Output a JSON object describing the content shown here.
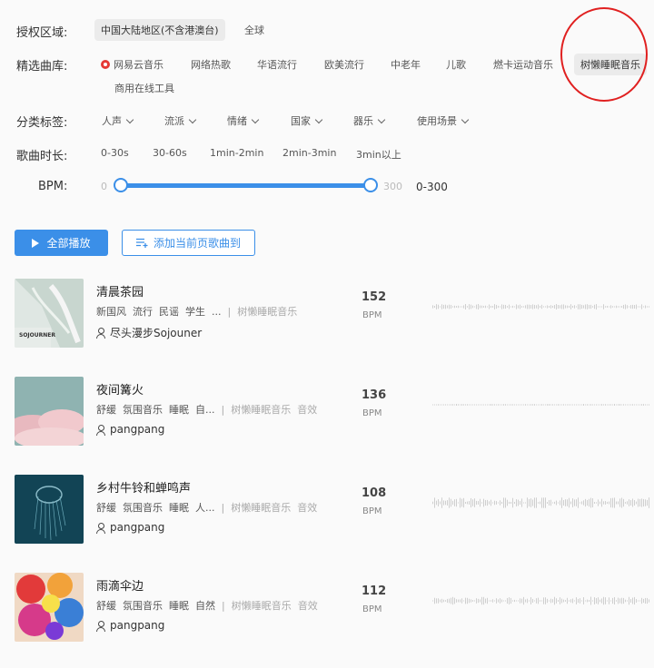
{
  "filters": {
    "region": {
      "label": "授权区域:",
      "options": [
        "中国大陆地区(不含港澳台)",
        "全球"
      ],
      "selected": 0
    },
    "library": {
      "label": "精选曲库:",
      "options": [
        "网易云音乐",
        "网络热歌",
        "华语流行",
        "欧美流行",
        "中老年",
        "儿歌",
        "燃卡运动音乐",
        "树懒睡眠音乐",
        "商用在线工具"
      ],
      "selected": 7
    },
    "category": {
      "label": "分类标签:",
      "options": [
        "人声",
        "流派",
        "情绪",
        "国家",
        "器乐",
        "使用场景"
      ]
    },
    "duration": {
      "label": "歌曲时长:",
      "options": [
        "0-30s",
        "30-60s",
        "1min-2min",
        "2min-3min",
        "3min以上"
      ]
    },
    "bpm": {
      "label": "BPM:",
      "min": "0",
      "max": "300",
      "range": "0-300"
    }
  },
  "actions": {
    "play_all": "全部播放",
    "add_page": "添加当前页歌曲到"
  },
  "songs": [
    {
      "title": "清晨茶园",
      "tags": [
        "新国风",
        "流行",
        "民谣",
        "学生",
        "..."
      ],
      "source": "树懒睡眠音乐",
      "extra": "",
      "artist": "尽头漫步Sojouner",
      "bpm": "152",
      "bpm_label": "BPM",
      "cover_text": "SOJOURNER"
    },
    {
      "title": "夜间篝火",
      "tags": [
        "舒缓",
        "氛围音乐",
        "睡眠",
        "自..."
      ],
      "source": "树懒睡眠音乐",
      "extra": "音效",
      "artist": "pangpang",
      "bpm": "136",
      "bpm_label": "BPM"
    },
    {
      "title": "乡村牛铃和蝉鸣声",
      "tags": [
        "舒缓",
        "氛围音乐",
        "睡眠",
        "人..."
      ],
      "source": "树懒睡眠音乐",
      "extra": "音效",
      "artist": "pangpang",
      "bpm": "108",
      "bpm_label": "BPM"
    },
    {
      "title": "雨滴伞边",
      "tags": [
        "舒缓",
        "氛围音乐",
        "睡眠",
        "自然"
      ],
      "source": "树懒睡眠音乐",
      "extra": "音效",
      "artist": "pangpang",
      "bpm": "112",
      "bpm_label": "BPM"
    }
  ],
  "colors": {
    "accent": "#3b8fe8",
    "annotation": "#e02020"
  }
}
